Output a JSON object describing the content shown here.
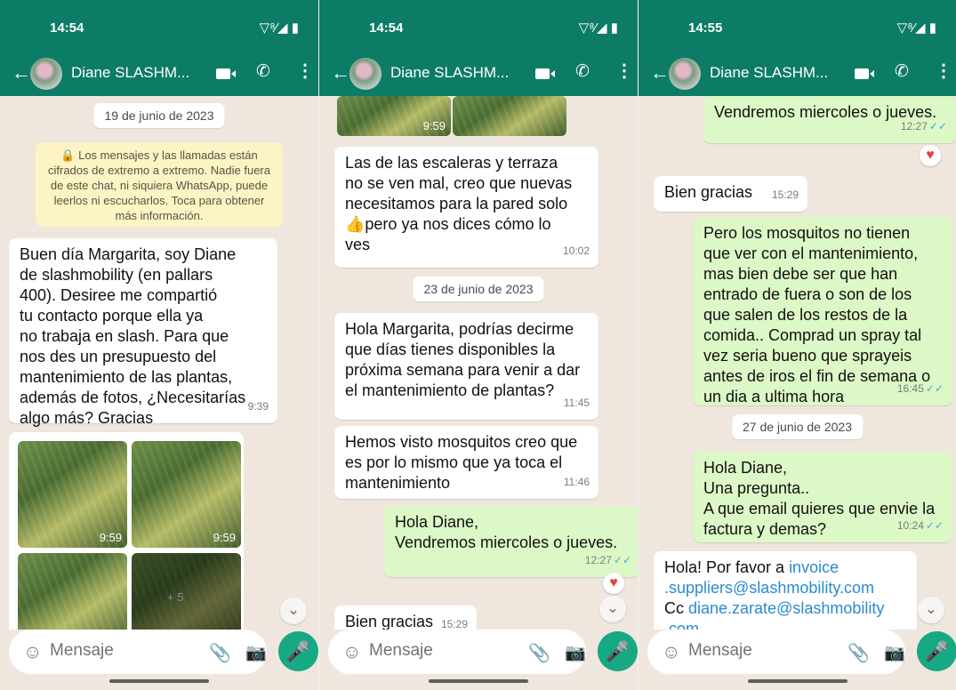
{
  "panels": [
    {
      "status_time": "14:54",
      "status_icons": "▽⁸⁄◢ ▮",
      "contact_name": "Diane SLASHM...",
      "date_divider": "19 de junio de 2023",
      "system_notice": "🔒 Los mensajes y las llamadas están cifrados de extremo a extremo. Nadie fuera de este chat, ni siquiera WhatsApp, puede leerlos ni escucharlos. Toca para obtener más información.",
      "message1_text": "Buen día Margarita, soy Diane\nde slashmobility (en pallars\n400). Desiree me compartió\ntu contacto porque ella ya\nno trabaja en slash. Para que\nnos des un presupuesto del\nmantenimiento de las plantas,\nademás de fotos, ¿Necesitarías\nalgo más? Gracias",
      "message1_time": "9:39",
      "photo1_time": "9:59",
      "photo2_time": "9:59",
      "more_photos": "+ 5",
      "input_placeholder": "Mensaje"
    },
    {
      "status_time": "14:54",
      "status_icons": "▽⁸⁄◢ ▮",
      "contact_name": "Diane SLASHM...",
      "photo_time": "9:59",
      "message1_text": "Las de las escaleras y terraza\nno se ven mal, creo que nuevas\nnecesitamos para la pared solo\n👍pero ya nos dices cómo lo\nves",
      "message1_time": "10:02",
      "date_divider": "23 de junio de 2023",
      "message2_text": "Hola Margarita, podrías decirme\nque días tienes disponibles la\npróxima semana para venir a dar\nel mantenimiento de plantas?",
      "message2_time": "11:45",
      "message3_text": "Hemos visto mosquitos creo que\nes por lo mismo que ya toca el\nmantenimiento",
      "message3_time": "11:46",
      "message4_text": "Hola Diane,\nVendremos miercoles o jueves.",
      "message4_time": "12:27",
      "message5_text": "Bien gracias",
      "message5_time": "15:29",
      "input_placeholder": "Mensaje"
    },
    {
      "status_time": "14:55",
      "status_icons": "▽⁸⁄◢ ▮",
      "contact_name": "Diane SLASHM...",
      "message1_text": "Vendremos miercoles o jueves.",
      "message1_time": "12:27",
      "message2_text": "Bien gracias",
      "message2_time": "15:29",
      "message3_text": "Pero los mosquitos no tienen\nque ver con el mantenimiento,\nmas bien debe ser que han\nentrado de fuera o son de los\nque salen de los restos de la\ncomida.. Comprad un spray tal\nvez seria bueno que sprayeis\nantes de iros el fin de semana o\nun dia a ultima hora",
      "message3_time": "16:45",
      "date_divider": "27 de junio de 2023",
      "message4_text": "Hola Diane,\nUna pregunta..\nA que email quieres que envie la\nfactura y demas?",
      "message4_time": "10:24",
      "message5_prefix": "Hola! Por favor a ",
      "message5_link1": "invoice\n.suppliers@slashmobility.com",
      "message5_cc": "\nCc ",
      "message5_link2": "diane.zarate@slashmobility\n.com",
      "input_placeholder": "Mensaje"
    }
  ]
}
